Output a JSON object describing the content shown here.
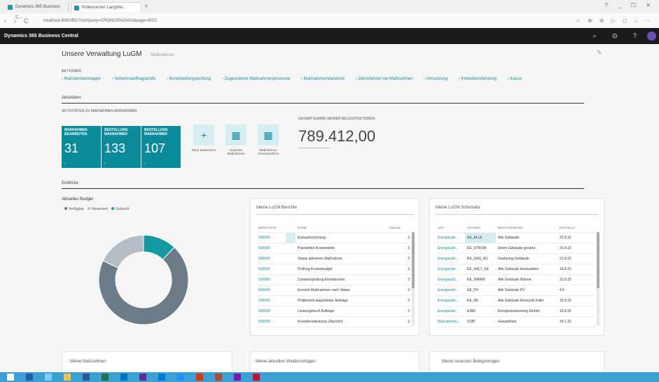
{
  "browser": {
    "tabs": [
      "Dynamics 365 Business C...",
      "Rollencenter Langtitel..."
    ],
    "new_tab": "+",
    "window_controls": "? _ ☐ ✕",
    "nav": {
      "back": "‹",
      "forward": "›",
      "refresh": "C"
    },
    "address": "localhost:8080/BC/?company=CRONUS%20AG&page=9022",
    "address_tools": "☆ ⊕ ⊗ ▷ ◻ ⌂ ⋯"
  },
  "app": {
    "title": "Dynamics 365 Business Central",
    "icons": "⌕ ⚙ ?"
  },
  "header": {
    "company": "Unsere Verwaltung LuGM",
    "company_sub": "Maßnahmen",
    "edit_icon": "✎"
  },
  "actions": {
    "label": "AKTIONEN",
    "items": [
      "› Maßnahmenmappe",
      "› Verkehrsauftragsprüfe",
      "› Bereitstellungsprüfung",
      "› Zugeordnete Maßnahmenprozesse",
      "› Maßnahmenstandorte",
      "› Dienstleister bei Maßnahmen",
      "› Umsetzung",
      "› Kreisdienstleistung",
      "› Kasse"
    ]
  },
  "activities": {
    "section": "Aktivitäten",
    "cue_group": "AKTIVITÄTEN ZU MAßNAHMEN MAßNAHMEN",
    "tiles": [
      {
        "title": "MAßNAHMEN BEARBEITEN",
        "value": "31",
        "arrow": "›"
      },
      {
        "title": "BESTELLUNG MAßNAHMEN",
        "value": "133",
        "arrow": "›"
      },
      {
        "title": "BESTELLUNG MAßNAHMEN",
        "value": "107",
        "arrow": "›"
      }
    ],
    "links": [
      {
        "icon": "+",
        "label": "Neue Maßnahme"
      },
      {
        "icon": "▦",
        "label": "Geplante Maßnahmen"
      },
      {
        "icon": "▦",
        "label": "Maßnahmen Verantwortliche"
      }
    ],
    "total_label": "GESAMTSUMME MEINER BELEGPOSITIONEN",
    "total_value": "789.412,00"
  },
  "insights": {
    "section": "Einblicke",
    "budget_title": "Aktuelles Budget",
    "legend": [
      {
        "label": "Verfügbar",
        "color": "#6b7b87"
      },
      {
        "label": "Reserviert",
        "color": "#b5bec4"
      },
      {
        "label": "Gebucht",
        "color": "#129aa0"
      }
    ]
  },
  "chart_data": {
    "type": "pie",
    "title": "Aktuelles Budget",
    "categories": [
      "Verfügbar",
      "Reserviert",
      "Gebucht"
    ],
    "values": [
      70,
      18,
      12
    ],
    "donut": true,
    "legend_position": "top-left"
  },
  "card1": {
    "title": "Meine LuGM Berichte",
    "columns": [
      "BERICHT-ID",
      "NAME",
      "ANZAHL"
    ],
    "rows": [
      [
        "500000",
        "Einkaufsrechnung",
        "3"
      ],
      [
        "500000",
        "Planstellen Kostenstelle",
        "3"
      ],
      [
        "500000",
        "Status aktivieren Maßnahme",
        "3"
      ],
      [
        "500000",
        "Prüfung Kostenbudget",
        "3"
      ],
      [
        "500000",
        "Zustandsprüfung Einzelposten",
        "3"
      ],
      [
        "500000",
        "Einsicht Maßnahmen nach Status",
        "3"
      ],
      [
        "500000",
        "Prüfbericht abgelehnter Aufträge",
        "3"
      ],
      [
        "500000",
        "Leistungsbuch Aufträge",
        "3"
      ],
      [
        "500000",
        "Kreisdienstleistung Übersicht",
        "3"
      ]
    ]
  },
  "card2": {
    "title": "Meine LuGM Schemata",
    "columns": [
      "ART",
      "SCHEMA",
      "BESCHREIBUNG",
      "ERSTELLT"
    ],
    "rows": [
      [
        "Energiezäh...",
        "EE_ALLE",
        "Alle Gebäude",
        "31.8.15"
      ],
      [
        "Energiezäh...",
        "EE_STROM",
        "Strom Gebäude gesamt",
        "31.8.15"
      ],
      [
        "Energiezäh...",
        "EE_GAS_NS",
        "Gasbezug Gebäude",
        "31.8.15"
      ],
      [
        "Energiezäh...",
        "EE_KALT_KE",
        "Alle Gebäude Kennzahlen",
        "16.8.15"
      ],
      [
        "Energiezäh...",
        "EE_WÄRM",
        "Alle Gebäude Wärme",
        "31.8.15"
      ],
      [
        "Energiezäh...",
        "EE_PV",
        "Alle Gebäude PV",
        "4.5"
      ],
      [
        "Energiezäh...",
        "EE_KE",
        "Alle Gebäude Kennzahl Kälte",
        "15.8.15"
      ],
      [
        "Energiezäh...",
        "EINR",
        "Energieauswertung Einheit",
        "15.8.15"
      ],
      [
        "Maßnahmen...",
        "STAT",
        "Gesamtliste",
        "30.1.15"
      ]
    ]
  },
  "bottom_cards": [
    "Meine Maßnahmen",
    "Meine aktuellen Wiedervorlagen",
    "Meine neuesten Belegvorlagen"
  ],
  "taskbar": {
    "icons": [
      "windows-logo",
      "search",
      "task-view",
      "explorer",
      "word",
      "excel",
      "outlook",
      "store",
      "mail",
      "edge",
      "office",
      "powerpoint",
      "onenote",
      "opera"
    ]
  }
}
